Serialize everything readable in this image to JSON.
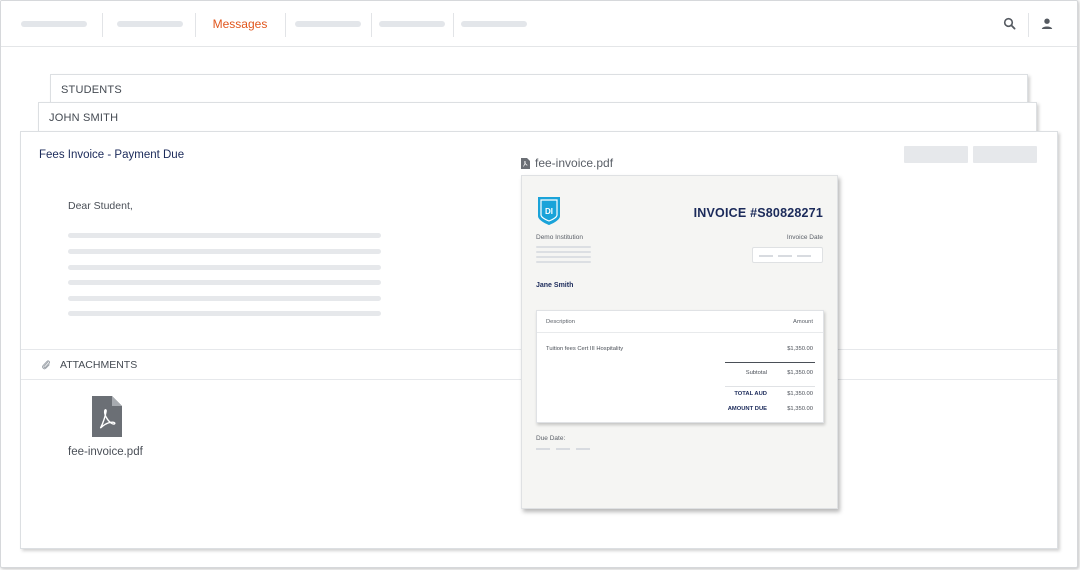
{
  "nav": {
    "active_label": "Messages"
  },
  "breadcrumbs": {
    "students_label": "STUDENTS",
    "student_name": "JOHN SMITH"
  },
  "message": {
    "subject": "Fees Invoice - Payment Due",
    "greeting": "Dear Student,"
  },
  "attachments": {
    "header": "ATTACHMENTS",
    "file_name": "fee-invoice.pdf"
  },
  "preview": {
    "file_name": "fee-invoice.pdf",
    "logo_text": "DI",
    "title": "INVOICE #S80828271",
    "institution": "Demo Institution",
    "invoice_date_label": "Invoice Date",
    "bill_to": "Jane Smith",
    "table": {
      "col_description": "Description",
      "col_amount": "Amount",
      "rows": [
        {
          "description": "Tuition fees Cert III Hospitality",
          "amount": "$1,350.00"
        }
      ],
      "subtotal_label": "Subtotal",
      "subtotal_value": "$1,350.00",
      "total_label": "TOTAL AUD",
      "total_value": "$1,350.00",
      "due_label": "AMOUNT DUE",
      "due_value": "$1,350.00"
    },
    "due_date_label": "Due Date:"
  },
  "colors": {
    "accent": "#e0561d",
    "navy": "#1b2a5a",
    "logo_blue": "#1aa3d9"
  },
  "icons": [
    "search-icon",
    "user-icon",
    "paperclip-icon",
    "pdf-file-icon"
  ]
}
